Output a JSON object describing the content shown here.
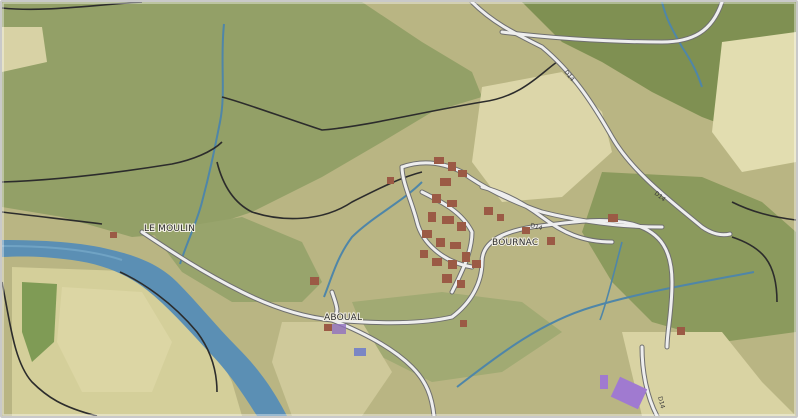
{
  "map": {
    "kind": "aerial orthophoto with cadastral and road overlay",
    "places": {
      "le_moulin": "LE MOULIN",
      "bournac": "BOURNAC",
      "aboual": "ABOUAL"
    },
    "roads": {
      "d_north": "D14",
      "d_east": "D14",
      "d_center": "D14",
      "d_south": "D14"
    },
    "colors": {
      "field_light": "#d9d5a8",
      "field_pale": "#e3ddb3",
      "forest": "#8e9c63",
      "forest_dark": "#6f7f45",
      "river": "#5b8fb4",
      "stream": "#4f86a8",
      "road_casing": "#6f6f6f",
      "road_fill": "#eeeeee",
      "track": "#2c2c2c",
      "roof": "#9b5a45",
      "purple_building": "#a07ad0"
    },
    "icons": [
      "frame-border"
    ]
  }
}
